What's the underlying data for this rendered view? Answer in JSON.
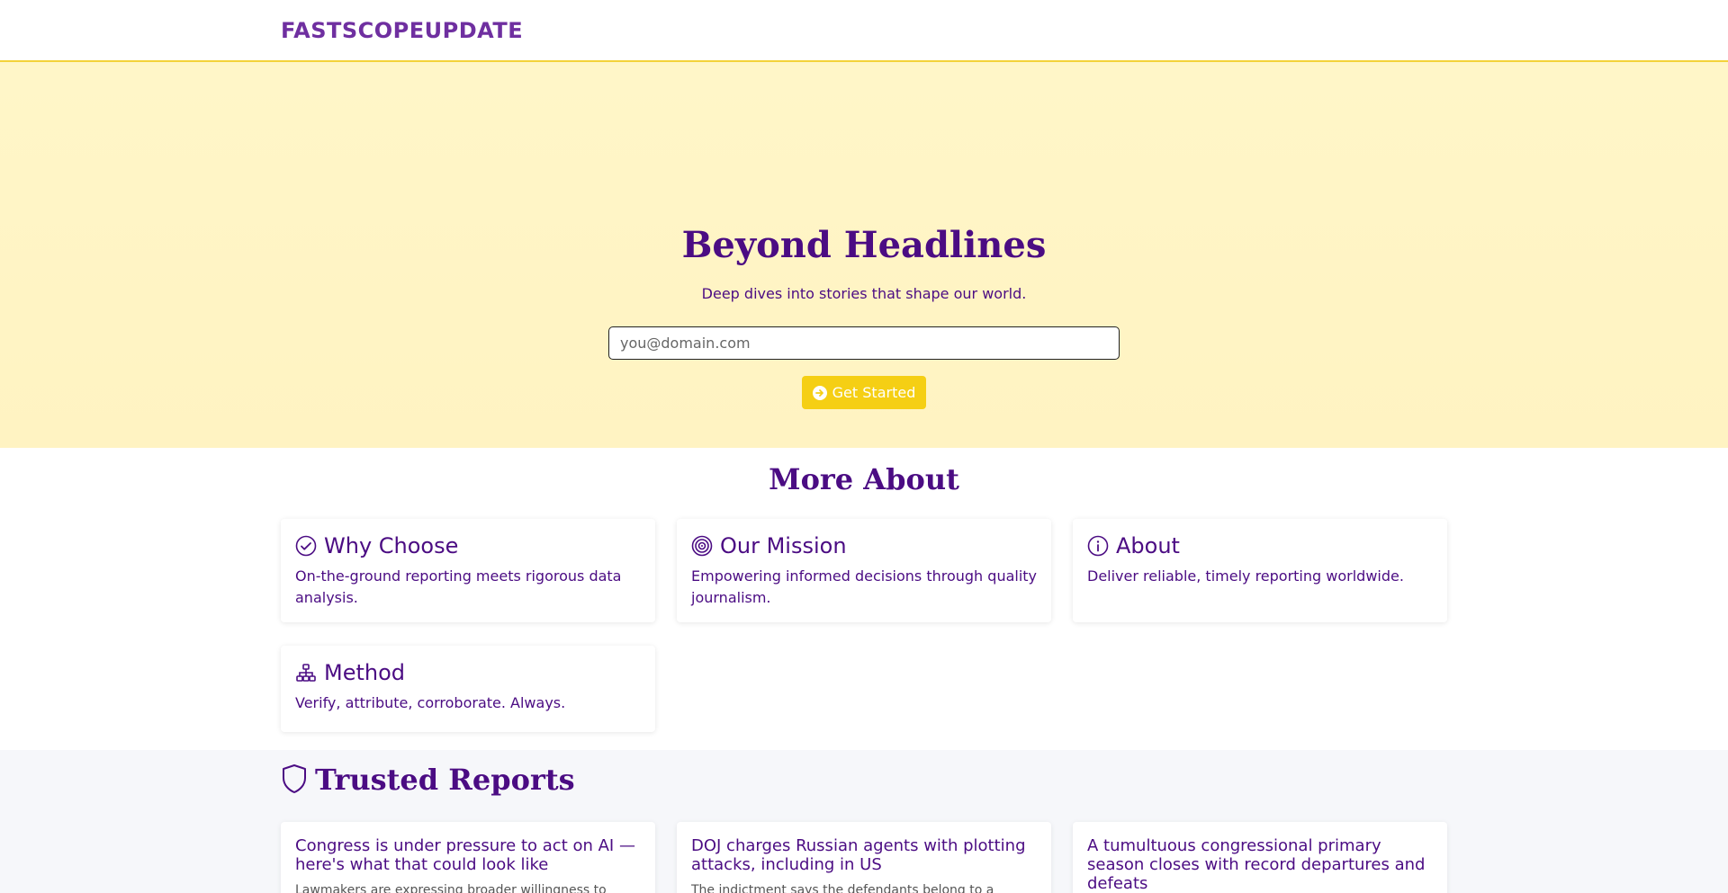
{
  "nav": {
    "brand": "FASTSCOPEUPDATE"
  },
  "hero": {
    "title": "Beyond Headlines",
    "subtitle": "Deep dives into stories that shape our world.",
    "email_placeholder": "you@domain.com",
    "cta_label": "Get Started",
    "cta_icon": "arrow-right-circle-icon"
  },
  "about": {
    "title": "More About",
    "cards": [
      {
        "icon": "check-circle-icon",
        "title": "Why Choose",
        "text": "On-the-ground reporting meets rigorous data analysis."
      },
      {
        "icon": "target-icon",
        "title": "Our Mission",
        "text": "Empowering informed decisions through quality journalism."
      },
      {
        "icon": "info-circle-icon",
        "title": "About",
        "text": "Deliver reliable, timely reporting worldwide."
      },
      {
        "icon": "diagram-icon",
        "title": "Method",
        "text": "Verify, attribute, corroborate. Always."
      }
    ]
  },
  "reports": {
    "title": "Trusted Reports",
    "icon": "shield-icon",
    "items": [
      {
        "title": "Congress is under pressure to act on AI — here's what that could look like",
        "text": "Lawmakers are expressing broader willingness to"
      },
      {
        "title": "DOJ charges Russian agents with plotting attacks, including in US",
        "text": "The indictment says the defendants belong to a"
      },
      {
        "title": "A tumultuous congressional primary season closes with record departures and defeats",
        "text": ""
      }
    ]
  },
  "colors": {
    "accent": "#f5cf14",
    "brand": "#6f2fa0",
    "text": "#4b0c83",
    "hero_bg": "#fff6c8"
  }
}
